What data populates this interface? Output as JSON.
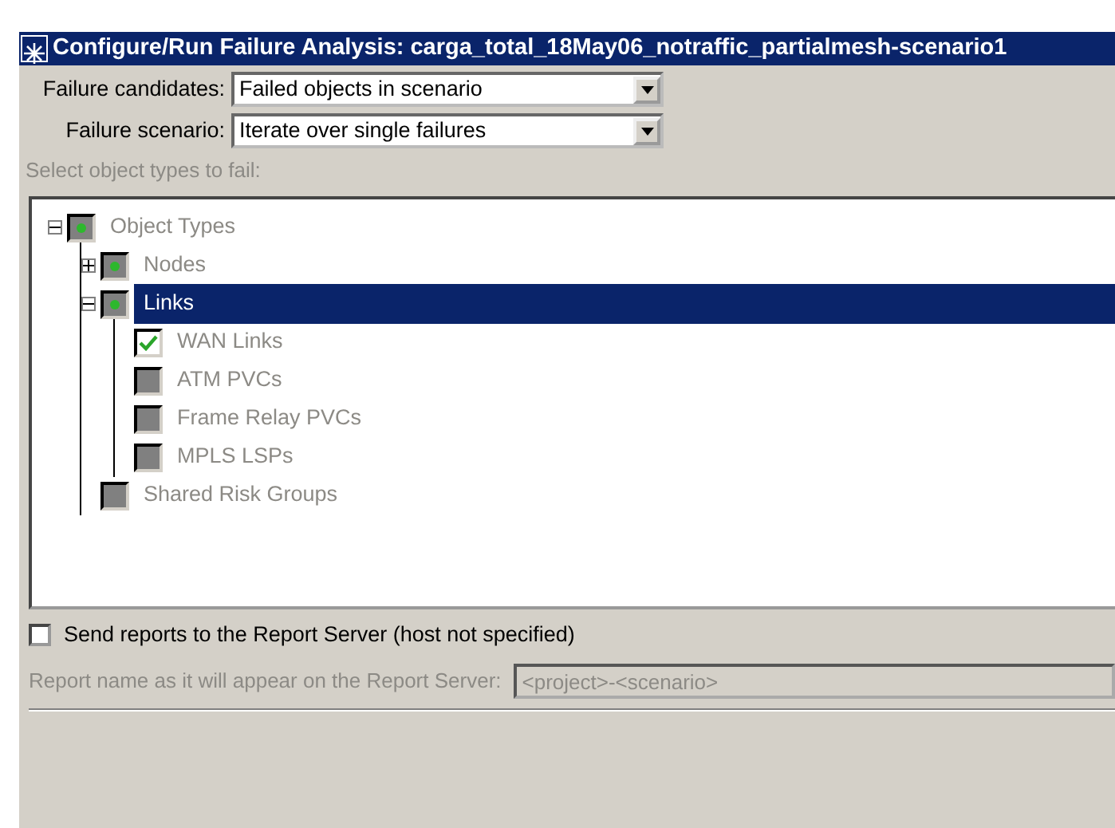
{
  "window": {
    "title": "Configure/Run Failure Analysis: carga_total_18May06_notraffic_partialmesh-scenario1"
  },
  "fields": [
    {
      "label": "Failure candidates:",
      "value": "Failed objects in scenario"
    },
    {
      "label": "Failure scenario:",
      "value": "Iterate over single failures"
    }
  ],
  "tree": {
    "label": "Select object types to fail:",
    "disabled": true,
    "items": [
      {
        "label": "Object Types",
        "checked": false,
        "partial": true,
        "expanded": true,
        "selected": false,
        "children": [
          {
            "label": "Nodes",
            "checked": false,
            "partial": true,
            "expanded": false,
            "selected": false
          },
          {
            "label": "Links",
            "checked": false,
            "partial": true,
            "expanded": true,
            "selected": true,
            "children": [
              {
                "label": "WAN Links",
                "checked": true,
                "partial": false,
                "selected": false
              },
              {
                "label": "ATM PVCs",
                "checked": false,
                "partial": false,
                "selected": false
              },
              {
                "label": "Frame Relay PVCs",
                "checked": false,
                "partial": false,
                "selected": false
              },
              {
                "label": "MPLS LSPs",
                "checked": false,
                "partial": false,
                "selected": false
              }
            ]
          },
          {
            "label": "Shared Risk Groups",
            "checked": false,
            "partial": false,
            "selected": false
          }
        ]
      }
    ]
  },
  "report": {
    "send_label": "Send reports to the Report Server (host not specified)",
    "checked": false,
    "name_label": "Report name as it will appear on the Report Server:",
    "name_value": "<project>-<scenario>",
    "disabled": true
  }
}
